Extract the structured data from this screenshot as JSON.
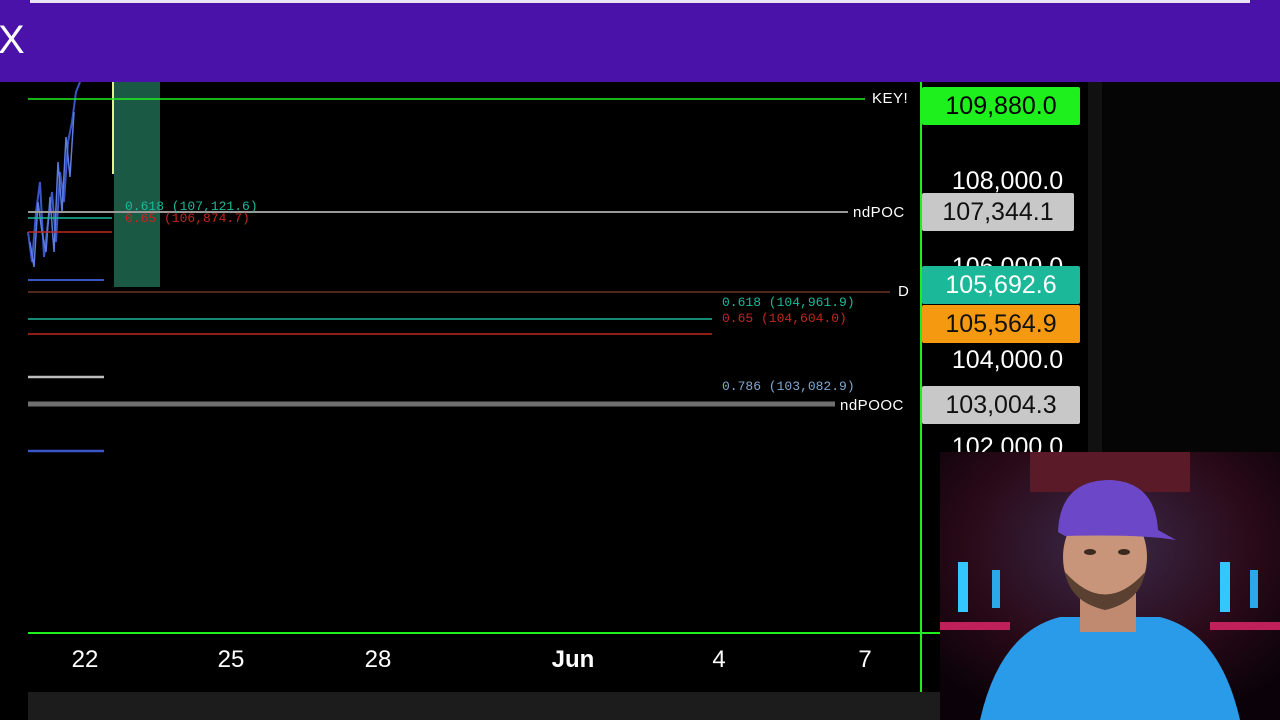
{
  "app": {
    "close_glyph": "X",
    "accent_color": "#4a12a8"
  },
  "chart": {
    "price_ticks": [
      "108,000.0",
      "106,000.0",
      "104,000.0",
      "102,000.0"
    ],
    "price_tags": [
      {
        "label": "109,880.0",
        "bg": "#1ef01e",
        "fg": "#000000"
      },
      {
        "label": "107,344.1",
        "bg": "#c8c8c8",
        "fg": "#111111"
      },
      {
        "label": "105,692.6",
        "bg": "#1bb89a",
        "fg": "#ffffff"
      },
      {
        "label": "105,564.9",
        "bg": "#f59a10",
        "fg": "#111111"
      },
      {
        "label": "103,004.3",
        "bg": "#c8c8c8",
        "fg": "#111111"
      }
    ],
    "line_names": {
      "key": "KEY!",
      "ndpoc": "ndPOC",
      "d": "D",
      "ndpooc": "ndPOOC"
    },
    "fib_labels": {
      "f618_a": "0.618 (107,121.6)",
      "f65_a": "0.65 (106,874.7)",
      "f618_b": "0.618 (104,961.9)",
      "f65_b": "0.65 (104,604.0)",
      "f786": "0.786 (103,082.9)"
    },
    "dates": [
      "22",
      "25",
      "28",
      "Jun",
      "4",
      "7"
    ],
    "colors": {
      "green": "#1ef01e",
      "teal": "#1bb89a",
      "red": "#c0281e",
      "gray": "#9a9a9a",
      "blue": "#3a55c8"
    }
  }
}
